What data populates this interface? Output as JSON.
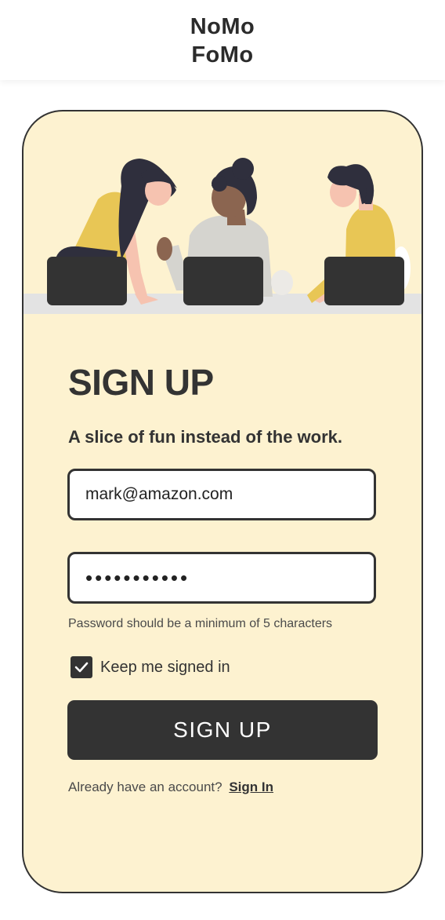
{
  "header": {
    "logo_line1": "NoMo",
    "logo_line2": "FoMo"
  },
  "form": {
    "title": "SIGN UP",
    "subtitle": "A slice of fun instead of the work.",
    "email_value": "mark@amazon.com",
    "password_mask": "•••••••••••",
    "password_hint": "Password should be a minimum of 5 characters",
    "keep_signed_in_label": "Keep me signed in",
    "keep_signed_in_checked": true,
    "submit_label": "SIGN UP",
    "already_text": "Already have an account?",
    "signin_link": "Sign In"
  },
  "colors": {
    "card_bg": "#fdf2d0",
    "dark": "#333333",
    "accent_yellow": "#e8c655"
  }
}
